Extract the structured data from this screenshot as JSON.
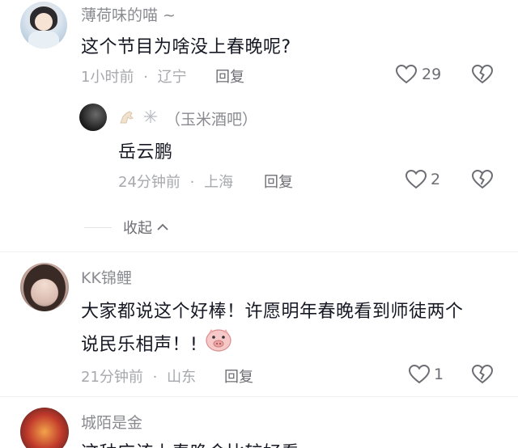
{
  "comments": [
    {
      "username": "薄荷味的喵 ~",
      "text": "这个节目为啥没上春晚呢?",
      "time": "1小时前",
      "location": "辽宁",
      "reply_label": "回复",
      "likes": "29",
      "replies": [
        {
          "username": "（玉米酒吧）",
          "text": "岳云鹏",
          "time": "24分钟前",
          "location": "上海",
          "reply_label": "回复",
          "likes": "2"
        }
      ],
      "collapse_label": "收起"
    },
    {
      "username": "KK锦鲤",
      "text_line1": "大家都说这个好棒！许愿明年春晚看到师徒两个",
      "text_line2": "说民乐相声！!",
      "time": "21分钟前",
      "location": "山东",
      "reply_label": "回复",
      "likes": "1"
    },
    {
      "username": "城陌是金",
      "text": "这种应该上春晚会比较好看"
    }
  ],
  "separator": "·",
  "icons": {
    "like": "heart-outline-icon",
    "dislike": "broken-heart-icon",
    "collapse": "chevron-up-icon",
    "emoji": "pig-face-emoji"
  },
  "colors": {
    "text": "#161823",
    "muted": "#a7a8ad",
    "username": "#8a8b91"
  }
}
